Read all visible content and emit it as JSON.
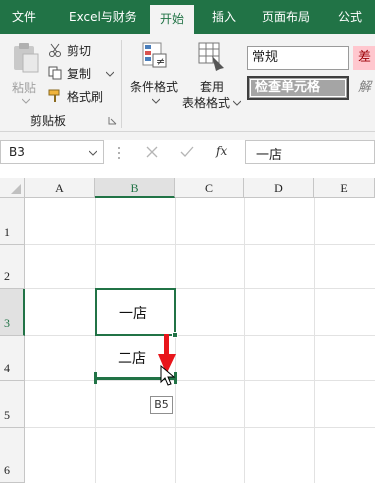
{
  "tabs": [
    "文件",
    "Excel与财务",
    "开始",
    "插入",
    "页面布局",
    "公式"
  ],
  "clipboard": {
    "paste": "粘贴",
    "cut": "剪切",
    "copy": "复制",
    "format_painter": "格式刷",
    "group_label": "剪贴板"
  },
  "styles": {
    "conditional_format": "条件格式",
    "apply_table_line1": "套用",
    "apply_table_line2": "表格格式",
    "style_normal": "常规",
    "style_check_cell": "检查单元格",
    "style_bad": "差",
    "style_explain": "解"
  },
  "formula_bar": {
    "name_box": "B3",
    "fx": "fx",
    "content": "一店"
  },
  "columns": [
    "A",
    "B",
    "C",
    "D",
    "E"
  ],
  "rows": [
    "1",
    "2",
    "3",
    "4",
    "5",
    "6"
  ],
  "cells": {
    "B3": "一店",
    "B4": "二店"
  },
  "drag_tooltip": "B5",
  "colors": {
    "excel_green": "#217346",
    "arrow_red": "#e8151b"
  }
}
